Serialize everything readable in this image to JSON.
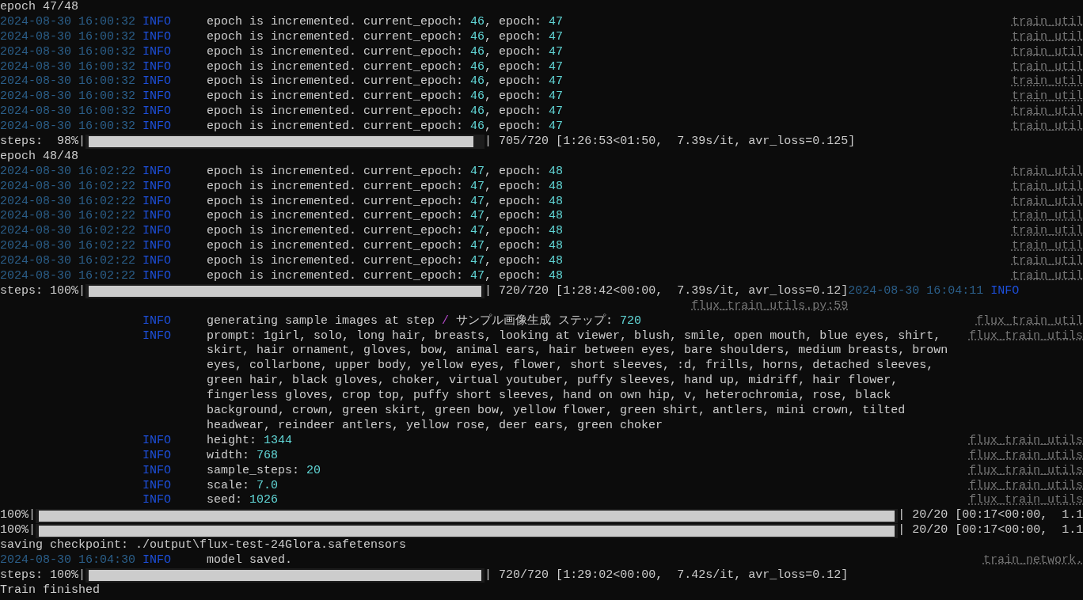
{
  "rows": [
    {
      "kind": "plain",
      "text": "epoch 47/48"
    },
    {
      "kind": "log",
      "time": "2024-08-30 16:00:32",
      "level": "INFO",
      "message": [
        {
          "kind": "plain",
          "text": "epoch is incremented. current_epoch: "
        },
        {
          "kind": "number",
          "text": "46"
        },
        {
          "kind": "plain",
          "text": ", epoch: "
        },
        {
          "kind": "number",
          "text": "47"
        }
      ],
      "source": "train_util"
    },
    {
      "kind": "log",
      "time": "2024-08-30 16:00:32",
      "level": "INFO",
      "message": [
        {
          "kind": "plain",
          "text": "epoch is incremented. current_epoch: "
        },
        {
          "kind": "number",
          "text": "46"
        },
        {
          "kind": "plain",
          "text": ", epoch: "
        },
        {
          "kind": "number",
          "text": "47"
        }
      ],
      "source": "train_util"
    },
    {
      "kind": "log",
      "time": "2024-08-30 16:00:32",
      "level": "INFO",
      "message": [
        {
          "kind": "plain",
          "text": "epoch is incremented. current_epoch: "
        },
        {
          "kind": "number",
          "text": "46"
        },
        {
          "kind": "plain",
          "text": ", epoch: "
        },
        {
          "kind": "number",
          "text": "47"
        }
      ],
      "source": "train_util"
    },
    {
      "kind": "log",
      "time": "2024-08-30 16:00:32",
      "level": "INFO",
      "message": [
        {
          "kind": "plain",
          "text": "epoch is incremented. current_epoch: "
        },
        {
          "kind": "number",
          "text": "46"
        },
        {
          "kind": "plain",
          "text": ", epoch: "
        },
        {
          "kind": "number",
          "text": "47"
        }
      ],
      "source": "train_util"
    },
    {
      "kind": "log",
      "time": "2024-08-30 16:00:32",
      "level": "INFO",
      "message": [
        {
          "kind": "plain",
          "text": "epoch is incremented. current_epoch: "
        },
        {
          "kind": "number",
          "text": "46"
        },
        {
          "kind": "plain",
          "text": ", epoch: "
        },
        {
          "kind": "number",
          "text": "47"
        }
      ],
      "source": "train_util"
    },
    {
      "kind": "log",
      "time": "2024-08-30 16:00:32",
      "level": "INFO",
      "message": [
        {
          "kind": "plain",
          "text": "epoch is incremented. current_epoch: "
        },
        {
          "kind": "number",
          "text": "46"
        },
        {
          "kind": "plain",
          "text": ", epoch: "
        },
        {
          "kind": "number",
          "text": "47"
        }
      ],
      "source": "train_util"
    },
    {
      "kind": "log",
      "time": "2024-08-30 16:00:32",
      "level": "INFO",
      "message": [
        {
          "kind": "plain",
          "text": "epoch is incremented. current_epoch: "
        },
        {
          "kind": "number",
          "text": "46"
        },
        {
          "kind": "plain",
          "text": ", epoch: "
        },
        {
          "kind": "number",
          "text": "47"
        }
      ],
      "source": "train_util"
    },
    {
      "kind": "log",
      "time": "2024-08-30 16:00:32",
      "level": "INFO",
      "message": [
        {
          "kind": "plain",
          "text": "epoch is incremented. current_epoch: "
        },
        {
          "kind": "number",
          "text": "46"
        },
        {
          "kind": "plain",
          "text": ", epoch: "
        },
        {
          "kind": "number",
          "text": "47"
        }
      ],
      "source": "train_util"
    },
    {
      "kind": "epoch_progress",
      "label": "steps:  98%|",
      "level": 0.98,
      "stats": "| 705/720 [1:26:53<01:50,  7.39s/it, avr_loss=0.125]"
    },
    {
      "kind": "plain",
      "text": "epoch 48/48"
    },
    {
      "kind": "log",
      "time": "2024-08-30 16:02:22",
      "level": "INFO",
      "message": [
        {
          "kind": "plain",
          "text": "epoch is incremented. current_epoch: "
        },
        {
          "kind": "number",
          "text": "47"
        },
        {
          "kind": "plain",
          "text": ", epoch: "
        },
        {
          "kind": "number",
          "text": "48"
        }
      ],
      "source": "train_util"
    },
    {
      "kind": "log",
      "time": "2024-08-30 16:02:22",
      "level": "INFO",
      "message": [
        {
          "kind": "plain",
          "text": "epoch is incremented. current_epoch: "
        },
        {
          "kind": "number",
          "text": "47"
        },
        {
          "kind": "plain",
          "text": ", epoch: "
        },
        {
          "kind": "number",
          "text": "48"
        }
      ],
      "source": "train_util"
    },
    {
      "kind": "log",
      "time": "2024-08-30 16:02:22",
      "level": "INFO",
      "message": [
        {
          "kind": "plain",
          "text": "epoch is incremented. current_epoch: "
        },
        {
          "kind": "number",
          "text": "47"
        },
        {
          "kind": "plain",
          "text": ", epoch: "
        },
        {
          "kind": "number",
          "text": "48"
        }
      ],
      "source": "train_util"
    },
    {
      "kind": "log",
      "time": "2024-08-30 16:02:22",
      "level": "INFO",
      "message": [
        {
          "kind": "plain",
          "text": "epoch is incremented. current_epoch: "
        },
        {
          "kind": "number",
          "text": "47"
        },
        {
          "kind": "plain",
          "text": ", epoch: "
        },
        {
          "kind": "number",
          "text": "48"
        }
      ],
      "source": "train_util"
    },
    {
      "kind": "log",
      "time": "2024-08-30 16:02:22",
      "level": "INFO",
      "message": [
        {
          "kind": "plain",
          "text": "epoch is incremented. current_epoch: "
        },
        {
          "kind": "number",
          "text": "47"
        },
        {
          "kind": "plain",
          "text": ", epoch: "
        },
        {
          "kind": "number",
          "text": "48"
        }
      ],
      "source": "train_util"
    },
    {
      "kind": "log",
      "time": "2024-08-30 16:02:22",
      "level": "INFO",
      "message": [
        {
          "kind": "plain",
          "text": "epoch is incremented. current_epoch: "
        },
        {
          "kind": "number",
          "text": "47"
        },
        {
          "kind": "plain",
          "text": ", epoch: "
        },
        {
          "kind": "number",
          "text": "48"
        }
      ],
      "source": "train_util"
    },
    {
      "kind": "log",
      "time": "2024-08-30 16:02:22",
      "level": "INFO",
      "message": [
        {
          "kind": "plain",
          "text": "epoch is incremented. current_epoch: "
        },
        {
          "kind": "number",
          "text": "47"
        },
        {
          "kind": "plain",
          "text": ", epoch: "
        },
        {
          "kind": "number",
          "text": "48"
        }
      ],
      "source": "train_util"
    },
    {
      "kind": "log",
      "time": "2024-08-30 16:02:22",
      "level": "INFO",
      "message": [
        {
          "kind": "plain",
          "text": "epoch is incremented. current_epoch: "
        },
        {
          "kind": "number",
          "text": "47"
        },
        {
          "kind": "plain",
          "text": ", epoch: "
        },
        {
          "kind": "number",
          "text": "48"
        }
      ],
      "source": "train_util"
    },
    {
      "kind": "epoch_progress",
      "label": "steps: 100%|",
      "level": 1,
      "stats": "| 720/720 [1:28:42<00:00,  7.39s/it, avr_loss=0.12]",
      "tail_time": "2024-08-30 16:04:11",
      "tail_level": "INFO"
    },
    {
      "kind": "wrapped_source",
      "source": "flux_train_utils.py:59"
    },
    {
      "kind": "log",
      "level": "INFO",
      "message": [
        {
          "kind": "plain",
          "text": "generating sample images at step "
        },
        {
          "kind": "slash",
          "text": "/"
        },
        {
          "kind": "plain",
          "text": " サンプル画像生成 ステップ: "
        },
        {
          "kind": "number",
          "text": "720"
        }
      ],
      "source": "flux_train_util"
    },
    {
      "kind": "log",
      "level": "INFO",
      "message": [
        {
          "kind": "plain",
          "text": "prompt: 1girl, solo, long hair, breasts, looking at viewer, blush, smile, open mouth, blue eyes, shirt,"
        }
      ],
      "source": "flux_train_utils"
    },
    {
      "kind": "log",
      "message": [
        {
          "kind": "plain",
          "text": "skirt, hair ornament, gloves, bow, animal ears, hair between eyes, bare shoulders, medium breasts, brown"
        }
      ]
    },
    {
      "kind": "log",
      "message": [
        {
          "kind": "plain",
          "text": "eyes, collarbone, upper body, yellow eyes, flower, short sleeves, :d, frills, horns, detached sleeves,"
        }
      ]
    },
    {
      "kind": "log",
      "message": [
        {
          "kind": "plain",
          "text": "green hair, black gloves, choker, virtual youtuber, puffy sleeves, hand up, midriff, hair flower,"
        }
      ]
    },
    {
      "kind": "log",
      "message": [
        {
          "kind": "plain",
          "text": "fingerless gloves, crop top, puffy short sleeves, hand on own hip, v, heterochromia, rose, black"
        }
      ]
    },
    {
      "kind": "log",
      "message": [
        {
          "kind": "plain",
          "text": "background, crown, green skirt, green bow, yellow flower, green shirt, antlers, mini crown, tilted"
        }
      ]
    },
    {
      "kind": "log",
      "message": [
        {
          "kind": "plain",
          "text": "headwear, reindeer antlers, yellow rose, deer ears, green choker"
        }
      ]
    },
    {
      "kind": "log",
      "level": "INFO",
      "message": [
        {
          "kind": "plain",
          "text": "height: "
        },
        {
          "kind": "number",
          "text": "1344"
        }
      ],
      "source": "flux_train_utils"
    },
    {
      "kind": "log",
      "level": "INFO",
      "message": [
        {
          "kind": "plain",
          "text": "width: "
        },
        {
          "kind": "number",
          "text": "768"
        }
      ],
      "source": "flux_train_utils"
    },
    {
      "kind": "log",
      "level": "INFO",
      "message": [
        {
          "kind": "plain",
          "text": "sample_steps: "
        },
        {
          "kind": "number",
          "text": "20"
        }
      ],
      "source": "flux_train_utils"
    },
    {
      "kind": "log",
      "level": "INFO",
      "message": [
        {
          "kind": "plain",
          "text": "scale: "
        },
        {
          "kind": "number",
          "text": "7.0"
        }
      ],
      "source": "flux_train_utils"
    },
    {
      "kind": "log",
      "level": "INFO",
      "message": [
        {
          "kind": "plain",
          "text": "seed: "
        },
        {
          "kind": "number",
          "text": "1026"
        }
      ],
      "source": "flux_train_utils"
    },
    {
      "kind": "sample_progress",
      "label": "100%|",
      "level": 1,
      "stats": "| 20/20 [00:17<00:00,  1.1"
    },
    {
      "kind": "sample_progress",
      "label": "100%|",
      "level": 1,
      "stats": "| 20/20 [00:17<00:00,  1.1"
    },
    {
      "kind": "plain",
      "text": "saving checkpoint: ./output\\flux-test-24Glora.safetensors"
    },
    {
      "kind": "log",
      "time": "2024-08-30 16:04:30",
      "level": "INFO",
      "message": [
        {
          "kind": "plain",
          "text": "model saved."
        }
      ],
      "source": "train_network."
    },
    {
      "kind": "epoch_progress",
      "label": "steps: 100%|",
      "level": 1,
      "stats": "| 720/720 [1:29:02<00:00,  7.42s/it, avr_loss=0.12]"
    },
    {
      "kind": "plain",
      "text": "Train finished"
    }
  ]
}
